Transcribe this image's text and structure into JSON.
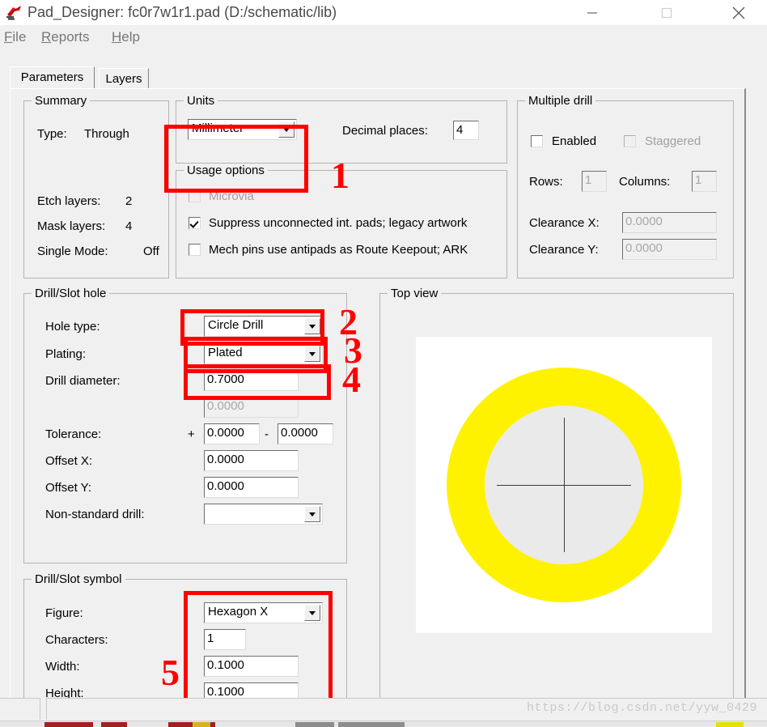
{
  "window": {
    "title": "Pad_Designer: fc0r7w1r1.pad (D:/schematic/lib)",
    "icon": "pad-designer-icon",
    "minimize_label": "—",
    "maximize_label": "□",
    "close_label": "✕"
  },
  "menu": [
    {
      "label": "File",
      "mnemonic": "F"
    },
    {
      "label": "Reports",
      "mnemonic": "R"
    },
    {
      "label": "Help",
      "mnemonic": "H"
    }
  ],
  "tabs": [
    {
      "label": "Parameters",
      "selected": true
    },
    {
      "label": "Layers",
      "selected": false
    }
  ],
  "summary": {
    "legend": "Summary",
    "rows": [
      {
        "label": "Type:",
        "value": "Through"
      },
      {
        "label": "Etch layers:",
        "value": "2"
      },
      {
        "label": "Mask layers:",
        "value": "4"
      },
      {
        "label": "Single Mode:",
        "value": "Off"
      }
    ]
  },
  "units": {
    "legend": "Units",
    "value": "Millimeter",
    "decimal_places_label": "Decimal places:",
    "decimal_places_value": "4"
  },
  "usage_options": {
    "legend": "Usage options",
    "items": [
      {
        "label": "Microvia",
        "checked": false,
        "enabled": false
      },
      {
        "label": "Suppress unconnected int. pads; legacy artwork",
        "checked": true,
        "enabled": true
      },
      {
        "label": "Mech pins use antipads as Route Keepout; ARK",
        "checked": false,
        "enabled": true
      }
    ]
  },
  "multiple_drill": {
    "legend": "Multiple drill",
    "enabled_label": "Enabled",
    "enabled_checked": false,
    "staggered_label": "Staggered",
    "staggered_checked": false,
    "rows_label": "Rows:",
    "rows_value": "1",
    "columns_label": "Columns:",
    "columns_value": "1",
    "clearance_x_label": "Clearance X:",
    "clearance_x_value": "0.0000",
    "clearance_y_label": "Clearance Y:",
    "clearance_y_value": "0.0000"
  },
  "drill_hole": {
    "legend": "Drill/Slot hole",
    "hole_type_label": "Hole type:",
    "hole_type_value": "Circle Drill",
    "plating_label": "Plating:",
    "plating_value": "Plated",
    "drill_diameter_label": "Drill diameter:",
    "drill_diameter_value": "0.7000",
    "drill_secondary_value": "0.0000",
    "tolerance_label": "Tolerance:",
    "tolerance_plus_sign": "+",
    "tolerance_plus_value": "0.0000",
    "tolerance_minus_sign": "-",
    "tolerance_minus_value": "0.0000",
    "offset_x_label": "Offset X:",
    "offset_x_value": "0.0000",
    "offset_y_label": "Offset Y:",
    "offset_y_value": "0.0000",
    "non_standard_label": "Non-standard drill:",
    "non_standard_value": ""
  },
  "drill_symbol": {
    "legend": "Drill/Slot symbol",
    "figure_label": "Figure:",
    "figure_value": "Hexagon X",
    "characters_label": "Characters:",
    "characters_value": "1",
    "width_label": "Width:",
    "width_value": "0.1000",
    "height_label": "Height:",
    "height_value": "0.1000"
  },
  "top_view": {
    "legend": "Top view",
    "pad_color": "#fff200",
    "hole_color": "#eaeaea",
    "canvas_color": "#ffffff",
    "crosshair_color": "#3c3c3c"
  },
  "annotations": {
    "accent_color": "#ff0000",
    "markers": [
      {
        "id": "1",
        "target": "units-combo"
      },
      {
        "id": "2",
        "target": "hole-type-combo"
      },
      {
        "id": "3",
        "target": "plating-combo"
      },
      {
        "id": "4",
        "target": "drill-diameter-field"
      },
      {
        "id": "5",
        "target": "drill-symbol-fields"
      }
    ]
  },
  "watermark": {
    "text": "https://blog.csdn.net/yyw_0429"
  }
}
